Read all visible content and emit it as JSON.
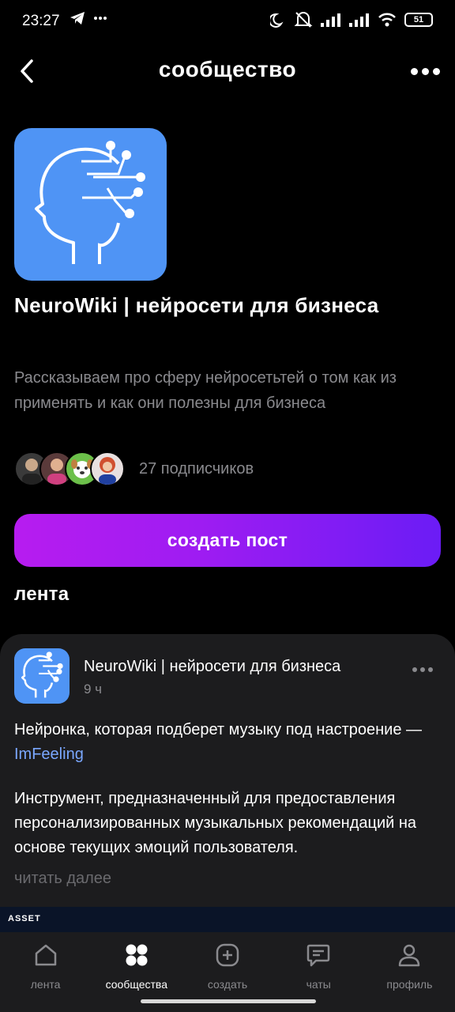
{
  "status": {
    "time": "23:27",
    "battery": "51"
  },
  "header": {
    "title": "сообщество",
    "back_icon": "chevron-left-icon",
    "more_icon": "more-horizontal-icon"
  },
  "community": {
    "name": "NeuroWiki | нейросети для бизнеса",
    "description": "Рассказываем про сферу нейросетьтей о том как из применять и как они полезны для бизнеса",
    "subscribers_text": "27 подписчиков",
    "avatar_color": "#4f94f5"
  },
  "actions": {
    "create_post": "создать пост"
  },
  "feed": {
    "title": "лента",
    "post": {
      "author": "NeuroWiki | нейросети для бизнеса",
      "time": "9 ч",
      "text1": "Нейронка, которая подберет музыку под настроение — ",
      "link": "ImFeeling",
      "text2": "Инструмент, предназначенный для предоставления персонализированных музыкальных рекомендаций на основе текущих эмоций пользователя.",
      "read_more": "читать далее"
    }
  },
  "ad": {
    "label": "ASSET"
  },
  "tabs": [
    {
      "label": "лента",
      "icon": "home-icon",
      "active": false
    },
    {
      "label": "сообщества",
      "icon": "grid-icon",
      "active": true
    },
    {
      "label": "создать",
      "icon": "plus-square-icon",
      "active": false
    },
    {
      "label": "чаты",
      "icon": "chat-icon",
      "active": false
    },
    {
      "label": "профиль",
      "icon": "user-icon",
      "active": false
    }
  ],
  "colors": {
    "accent_start": "#b71cf0",
    "accent_end": "#6b1cf5",
    "link": "#7aa7ff",
    "card": "#1c1c1e"
  }
}
